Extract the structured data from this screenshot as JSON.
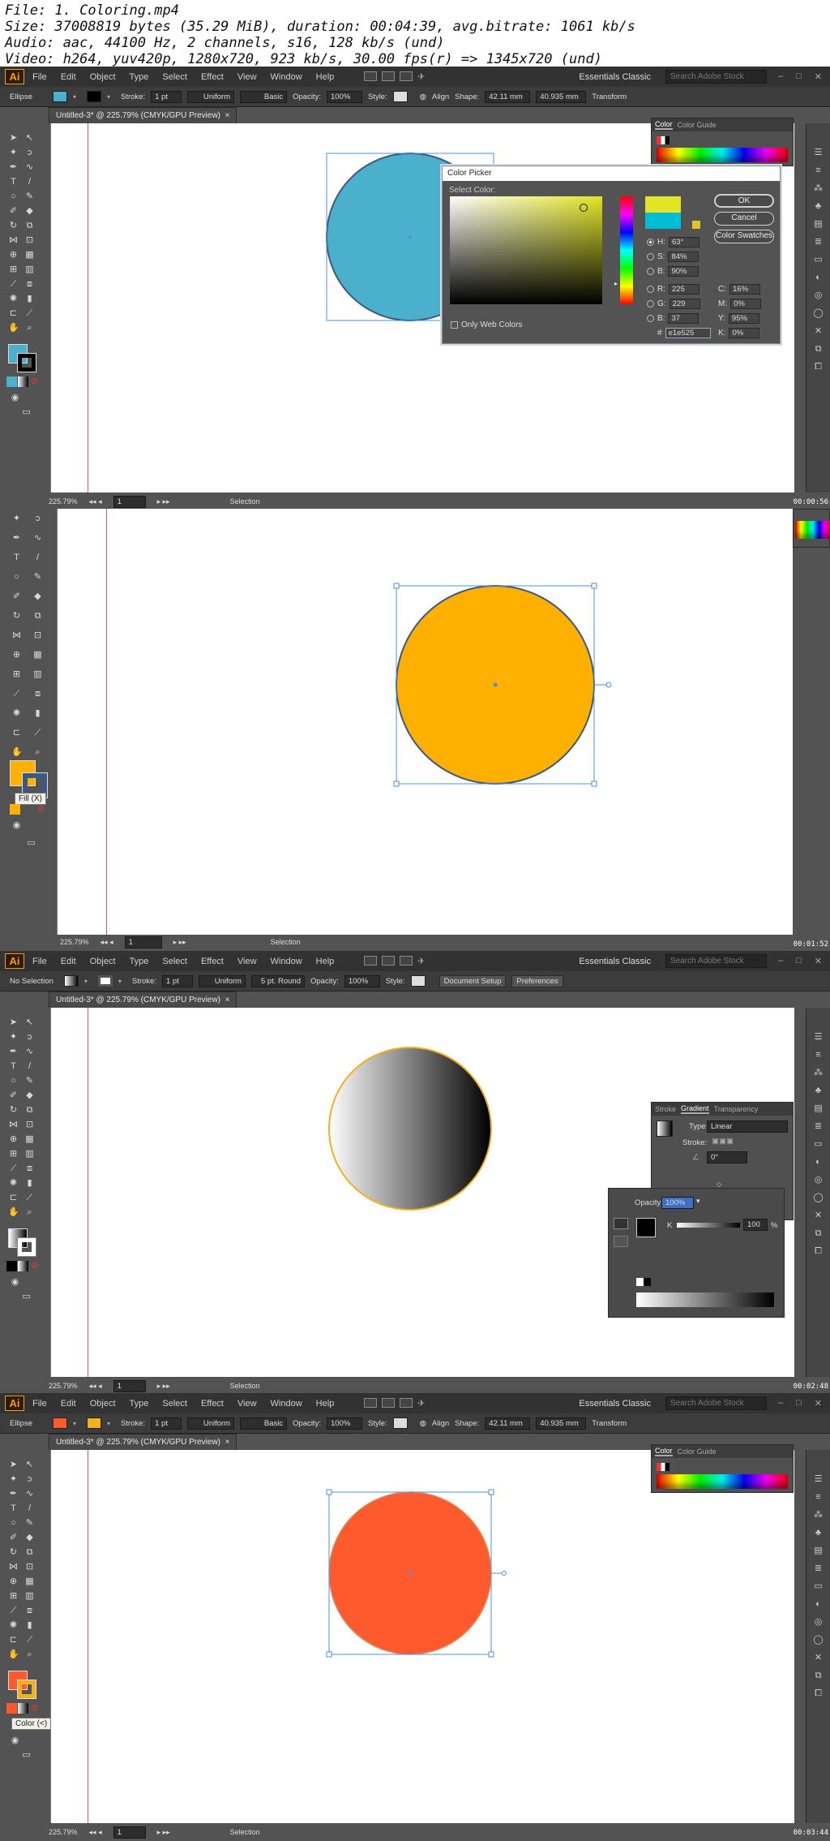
{
  "meta": {
    "file": "File: 1. Coloring.mp4",
    "size": "Size: 37008819 bytes (35.29 MiB), duration: 00:04:39, avg.bitrate: 1061 kb/s",
    "audio": "Audio: aac, 44100 Hz, 2 channels, s16, 128 kb/s (und)",
    "video": "Video: h264, yuv420p, 1280x720, 923 kb/s, 30.00 fps(r) => 1345x720 (und)"
  },
  "app": {
    "logo": "Ai",
    "menu": [
      "File",
      "Edit",
      "Object",
      "Type",
      "Select",
      "Effect",
      "View",
      "Window",
      "Help"
    ],
    "workspace": "Essentials Classic",
    "search_placeholder": "Search Adobe Stock",
    "doc_tab": "Untitled-3* @ 225.79% (CMYK/GPU Preview)",
    "tab_close": "×",
    "zoom": "225.79%",
    "artboard": "1",
    "status": "Selection"
  },
  "control": {
    "ellipse": "Ellipse",
    "no_selection": "No Selection",
    "stroke": "Stroke:",
    "stroke_weight": "1 pt",
    "uniform": "Uniform",
    "basic": "Basic",
    "round": "5 pt. Round",
    "opacity": "Opacity:",
    "opacity_value": "100%",
    "style": "Style:",
    "align": "Align",
    "shape": "Shape:",
    "w_value": "42.11 mm",
    "h_value": "40.935 mm",
    "transform": "Transform",
    "document_setup": "Document Setup",
    "preferences": "Preferences"
  },
  "color_panel": {
    "tab_color": "Color",
    "tab_guide": "Color Guide"
  },
  "color_picker": {
    "title": "Color Picker",
    "select_label": "Select Color:",
    "ok": "OK",
    "cancel": "Cancel",
    "swatches": "Color Swatches",
    "only_web": "Only Web Colors",
    "h_label": "H:",
    "h_value": "63°",
    "s_label": "S:",
    "s_value": "84%",
    "b_label": "B:",
    "b_value": "90%",
    "r_label": "R:",
    "r_value": "225",
    "g_label": "G:",
    "g_value": "229",
    "bb_label": "B:",
    "bb_value": "37",
    "hex_label": "#",
    "hex_value": "e1e525",
    "c_label": "C:",
    "c_value": "16%",
    "m_label": "M:",
    "m_value": "0%",
    "y_label": "Y:",
    "y_value": "95%",
    "k_label": "K:",
    "k_value": "0%"
  },
  "gradient_panel": {
    "tab_stroke": "Stroke",
    "tab_gradient": "Gradient",
    "tab_transparency": "Transparency",
    "type_label": "Type:",
    "type_value": "Linear",
    "stroke_label": "Stroke:",
    "angle_value": "0°"
  },
  "opacity_popup": {
    "label": "Opacity:",
    "value": "100%",
    "k_label": "K",
    "k_value": "100",
    "pct": "%"
  },
  "tooltips": {
    "fill": "Fill (X)",
    "color": "Color (<)"
  },
  "timestamps": [
    "00:00:56",
    "00:01:52",
    "00:02:48",
    "00:03:44"
  ],
  "colors": {
    "circle_blue": "#4ab0cc",
    "circle_orange": "#ffb000",
    "circle_red": "#ff5a2e",
    "stroke_blue": "#3c5a80",
    "selection_blue": "#4a90e2",
    "gradient_stroke": "#f0b020",
    "picked_new": "#e1e525",
    "picked_old": "#00bcd4"
  }
}
